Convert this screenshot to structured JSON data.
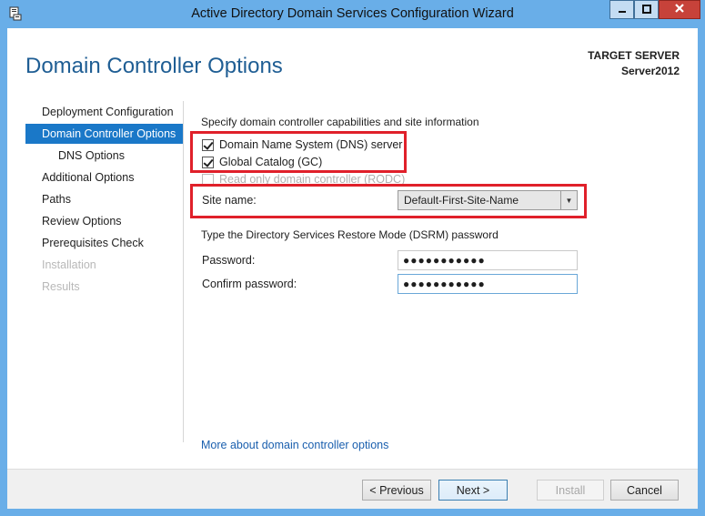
{
  "window": {
    "title": "Active Directory Domain Services Configuration Wizard",
    "minimize_icon": "minimize-icon",
    "maximize_icon": "maximize-icon",
    "close_icon": "close-icon"
  },
  "header": {
    "page_title": "Domain Controller Options",
    "target_label": "TARGET SERVER",
    "target_server": "Server2012"
  },
  "nav": {
    "items": [
      {
        "label": "Deployment Configuration",
        "state": "normal"
      },
      {
        "label": "Domain Controller Options",
        "state": "active"
      },
      {
        "label": "DNS Options",
        "state": "sub"
      },
      {
        "label": "Additional Options",
        "state": "normal"
      },
      {
        "label": "Paths",
        "state": "normal"
      },
      {
        "label": "Review Options",
        "state": "normal"
      },
      {
        "label": "Prerequisites Check",
        "state": "normal"
      },
      {
        "label": "Installation",
        "state": "disabled"
      },
      {
        "label": "Results",
        "state": "disabled"
      }
    ]
  },
  "main": {
    "capabilities_label": "Specify domain controller capabilities and site information",
    "checkboxes": [
      {
        "label": "Domain Name System (DNS) server",
        "checked": true,
        "enabled": true
      },
      {
        "label": "Global Catalog (GC)",
        "checked": true,
        "enabled": true
      },
      {
        "label": "Read only domain controller (RODC)",
        "checked": false,
        "enabled": false
      }
    ],
    "site_name_label": "Site name:",
    "site_name_value": "Default-First-Site-Name",
    "dsrm_label": "Type the Directory Services Restore Mode (DSRM) password",
    "password_label": "Password:",
    "password_value": "●●●●●●●●●●●",
    "confirm_label": "Confirm password:",
    "confirm_value": "●●●●●●●●●●●",
    "more_link": "More about domain controller options"
  },
  "footer": {
    "previous_label": "< Previous",
    "next_label": "Next >",
    "install_label": "Install",
    "cancel_label": "Cancel"
  },
  "colors": {
    "title_bar": "#69aee8",
    "accent": "#1a78c8",
    "page_title": "#1f5e94",
    "highlight": "#e0202a",
    "close_button": "#c7423a"
  }
}
